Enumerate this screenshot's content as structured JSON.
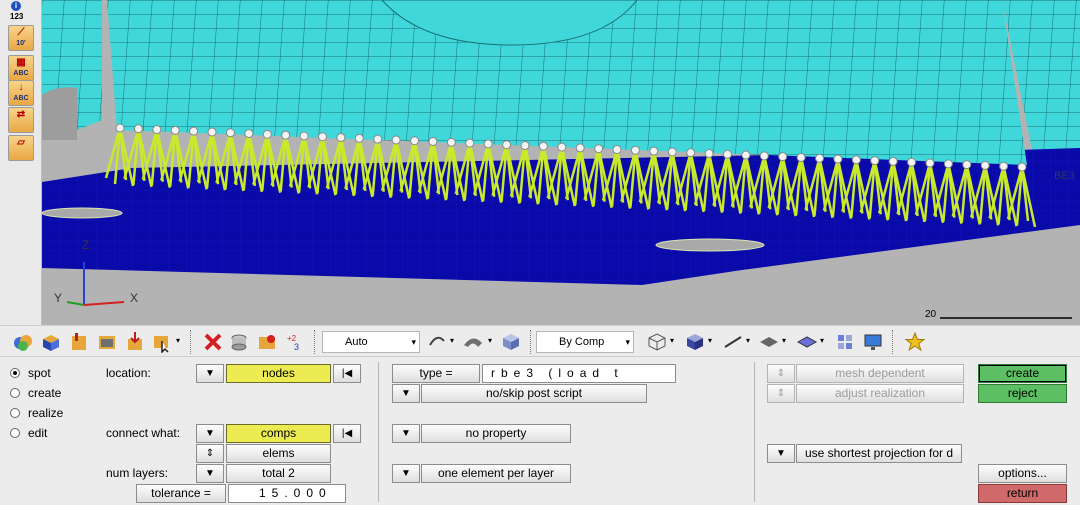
{
  "left_toolbar": {
    "count_label": "123",
    "items": [
      {
        "icon": "measure-icon",
        "text": "10'"
      },
      {
        "icon": "label-abc-icon",
        "text": "ABC"
      },
      {
        "icon": "arrow-label-icon",
        "text": "ABC"
      },
      {
        "icon": "mesh-swap-icon",
        "text": ""
      },
      {
        "icon": "surface-icon",
        "text": ""
      }
    ]
  },
  "viewport": {
    "node_label": "BE3",
    "axis": {
      "x": "X",
      "y": "Y",
      "z": "Z"
    },
    "scale_label": "20",
    "colors": {
      "mesh": "#3fd7d9",
      "plate": "#0a0aa8",
      "rbe": "#c9ea2b",
      "ground": "#b5b5b5"
    }
  },
  "toolbar": {
    "display_mode": "Auto",
    "color_mode": "By Comp",
    "icons": [
      "components-icon",
      "solid-box-icon",
      "mask-icon",
      "window-icon",
      "find-icon",
      "select-icon",
      "delete-icon",
      "cylinder-icon",
      "folder-icon",
      "numbers-icon",
      "view-icon",
      "rotate-icon",
      "shading-icon",
      "cube-icon",
      "color-icon",
      "wireframe-icon",
      "solid-cube-icon",
      "line-icon",
      "layer-icon",
      "plane-icon",
      "grid-icon",
      "monitor-icon",
      "star-icon"
    ]
  },
  "panel": {
    "modes": [
      {
        "label": "spot",
        "selected": true
      },
      {
        "label": "create",
        "selected": false
      },
      {
        "label": "realize",
        "selected": false
      },
      {
        "label": "edit",
        "selected": false
      }
    ],
    "location_label": "location:",
    "location_value": "nodes",
    "connect_label": "connect what:",
    "connect_value": "comps",
    "connect_sub": "elems",
    "layers_label": "num layers:",
    "layers_value": "total 2",
    "tolerance_label": "tolerance =",
    "tolerance_value": "15.000",
    "type_label": "type =",
    "type_value": "rbe3 (load t",
    "post_script": "no/skip post script",
    "property": "no property",
    "element_per_layer": "one element per layer",
    "mesh_dependent": "mesh dependent",
    "adjust_realization": "adjust realization",
    "projection": "use shortest projection for d",
    "create": "create",
    "reject": "reject",
    "options": "options...",
    "return": "return"
  }
}
